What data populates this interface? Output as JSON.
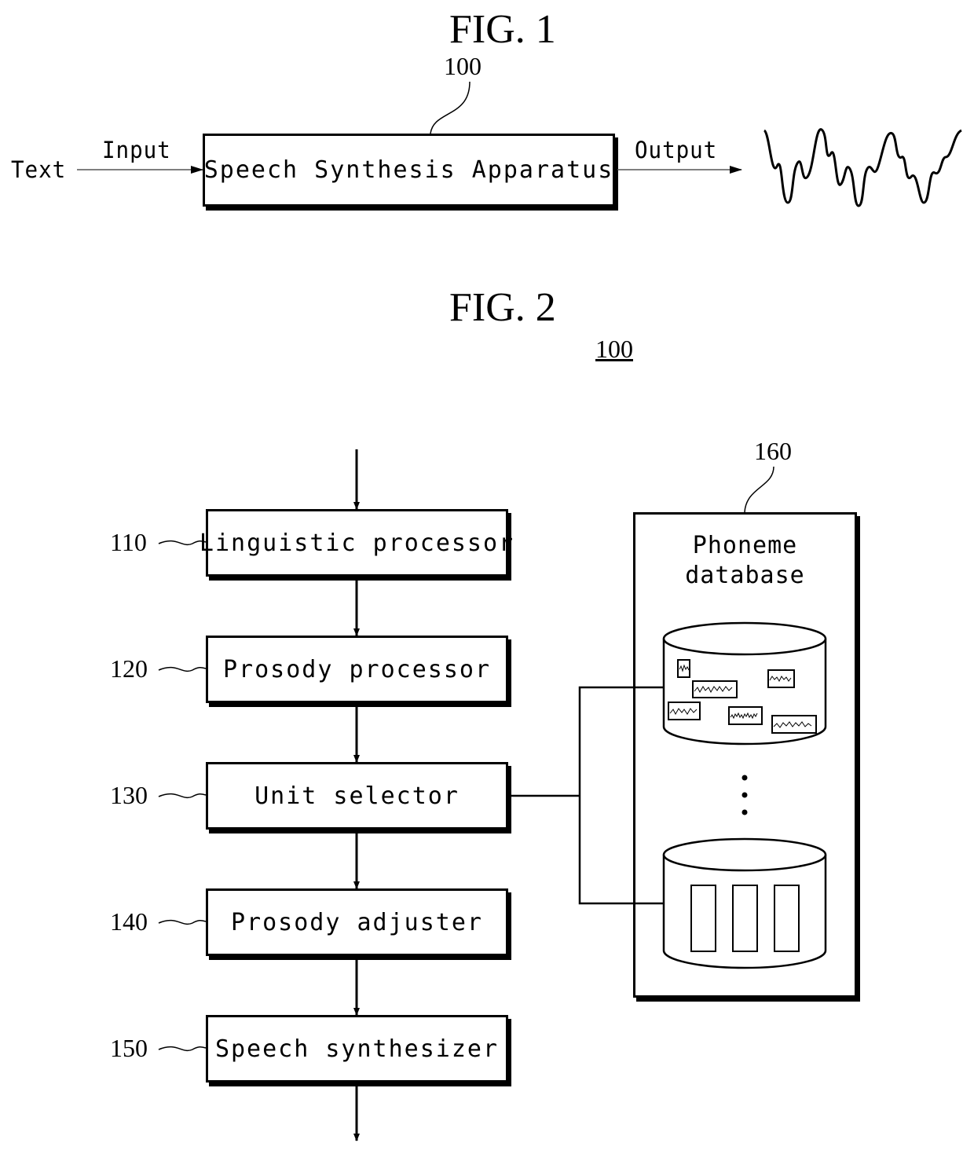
{
  "fig1": {
    "title": "FIG. 1",
    "ref_number": "100",
    "input_source": "Text",
    "input_label": "Input",
    "block": "Speech Synthesis Apparatus",
    "output_label": "Output",
    "output_icon": "waveform-icon"
  },
  "fig2": {
    "title": "FIG. 2",
    "ref_number": "100",
    "blocks": [
      {
        "ref": "110",
        "label": "Linguistic processor"
      },
      {
        "ref": "120",
        "label": "Prosody processor"
      },
      {
        "ref": "130",
        "label": "Unit selector"
      },
      {
        "ref": "140",
        "label": "Prosody adjuster"
      },
      {
        "ref": "150",
        "label": "Speech synthesizer"
      }
    ],
    "database": {
      "ref": "160",
      "label_line1": "Phoneme",
      "label_line2": "database",
      "ellipsis": "⋮",
      "cylinder1_icon": "waveform-database-icon",
      "cylinder2_icon": "slots-database-icon"
    }
  }
}
